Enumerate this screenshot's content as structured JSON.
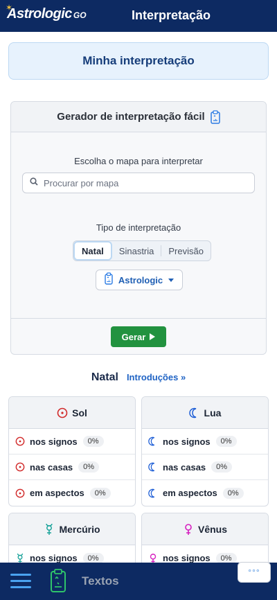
{
  "header": {
    "logo_text": "Astrologic",
    "logo_suffix": "GO",
    "title": "Interpretação"
  },
  "banner": {
    "title": "Minha interpretação"
  },
  "generator": {
    "title": "Gerador de interpretação fácil",
    "choose_label": "Escolha o mapa para interpretar",
    "search_placeholder": "Procurar por mapa",
    "type_label": "Tipo de interpretação",
    "tabs": [
      {
        "label": "Natal",
        "selected": true
      },
      {
        "label": "Sinastria",
        "selected": false
      },
      {
        "label": "Previsão",
        "selected": false
      }
    ],
    "source_dropdown": "Astrologic",
    "generate_button": "Gerar"
  },
  "section": {
    "title": "Natal",
    "link": "Introduções »"
  },
  "planets": [
    {
      "name": "Sol",
      "icon": "sun-icon",
      "color": "#d12a2a",
      "rows": [
        {
          "label": "nos signos",
          "pct": "0%"
        },
        {
          "label": "nas casas",
          "pct": "0%"
        },
        {
          "label": "em aspectos",
          "pct": "0%"
        }
      ]
    },
    {
      "name": "Lua",
      "icon": "moon-icon",
      "color": "#1f5fd6",
      "rows": [
        {
          "label": "nos signos",
          "pct": "0%"
        },
        {
          "label": "nas casas",
          "pct": "0%"
        },
        {
          "label": "em aspectos",
          "pct": "0%"
        }
      ]
    },
    {
      "name": "Mercúrio",
      "icon": "mercury-icon",
      "color": "#1aa39a",
      "rows": [
        {
          "label": "nos signos",
          "pct": "0%"
        }
      ]
    },
    {
      "name": "Vênus",
      "icon": "venus-icon",
      "color": "#d61fbf",
      "rows": [
        {
          "label": "nos signos",
          "pct": "0%"
        }
      ]
    }
  ],
  "bottom_nav": {
    "label": "Textos",
    "more": "°°°"
  }
}
